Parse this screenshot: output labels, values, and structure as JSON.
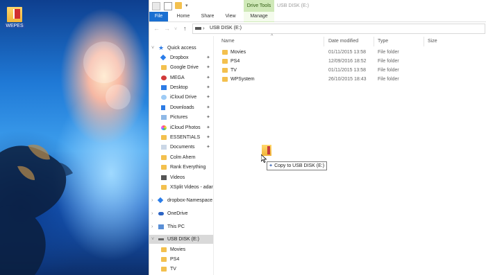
{
  "desktop": {
    "icon_label": "WEPES"
  },
  "titlebar": {
    "drive_tools": "Drive Tools",
    "title": "USB DISK (E:)"
  },
  "ribbon": {
    "tabs": [
      "File",
      "Home",
      "Share",
      "View",
      "Manage"
    ]
  },
  "address": {
    "path": "USB DISK (E:)"
  },
  "sidebar": {
    "items": [
      {
        "label": "Quick access",
        "icon": "star-icon",
        "pinned": false
      },
      {
        "label": "Dropbox",
        "icon": "dropbox-icon",
        "pinned": true
      },
      {
        "label": "Google Drive",
        "icon": "folder-icon",
        "pinned": true
      },
      {
        "label": "MEGA",
        "icon": "mega-icon",
        "pinned": true
      },
      {
        "label": "Desktop",
        "icon": "desktop-icon",
        "pinned": true
      },
      {
        "label": "iCloud Drive",
        "icon": "icloud-icon",
        "pinned": true
      },
      {
        "label": "Downloads",
        "icon": "download-icon",
        "pinned": true
      },
      {
        "label": "Pictures",
        "icon": "pictures-icon",
        "pinned": true
      },
      {
        "label": "iCloud Photos",
        "icon": "photos-icon",
        "pinned": true
      },
      {
        "label": "ESSENTIALS",
        "icon": "folder-icon",
        "pinned": true
      },
      {
        "label": "Documents",
        "icon": "documents-icon",
        "pinned": true
      },
      {
        "label": "Colm Ahern",
        "icon": "folder-icon",
        "pinned": false
      },
      {
        "label": "Rank Everything",
        "icon": "folder-icon",
        "pinned": false
      },
      {
        "label": "Videos",
        "icon": "videos-icon",
        "pinned": false
      },
      {
        "label": "XSplit Videos - adar",
        "icon": "folder-icon",
        "pinned": false
      },
      {
        "label": "dropbox-Namespace",
        "icon": "dropbox-icon",
        "pinned": false
      },
      {
        "label": "OneDrive",
        "icon": "onedrive-icon",
        "pinned": false
      },
      {
        "label": "This PC",
        "icon": "pc-icon",
        "pinned": false
      },
      {
        "label": "USB DISK (E:)",
        "icon": "usb-drive-icon",
        "pinned": false
      },
      {
        "label": "Movies",
        "icon": "folder-icon",
        "pinned": false
      },
      {
        "label": "PS4",
        "icon": "folder-icon",
        "pinned": false
      },
      {
        "label": "TV",
        "icon": "folder-icon",
        "pinned": false
      }
    ],
    "pin_glyph": "📌"
  },
  "columns": {
    "name": "Name",
    "date": "Date modified",
    "type": "Type",
    "size": "Size"
  },
  "files": [
    {
      "name": "Movies",
      "date": "01/11/2015 13:58",
      "type": "File folder"
    },
    {
      "name": "PS4",
      "date": "12/09/2016 18:52",
      "type": "File folder"
    },
    {
      "name": "TV",
      "date": "01/11/2015 13:58",
      "type": "File folder"
    },
    {
      "name": "WPSystem",
      "date": "26/10/2015 18:43",
      "type": "File folder"
    }
  ],
  "drag": {
    "tooltip": "Copy to USB DISK (E:)",
    "plus": "+"
  }
}
